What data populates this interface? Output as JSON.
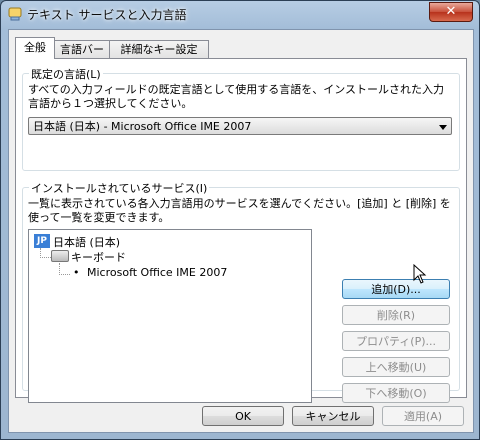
{
  "window": {
    "title": "テキスト サービスと入力言語",
    "close_symbol": "✕"
  },
  "tabs": [
    {
      "label": "全般",
      "active": true
    },
    {
      "label": "言語バー",
      "active": false
    },
    {
      "label": "詳細なキー設定",
      "active": false
    }
  ],
  "default_language": {
    "group_label": "既定の言語(L)",
    "description": "すべての入力フィールドの既定言語として使用する言語を、インストールされた入力言語から１つ選択してください。",
    "selected": "日本語 (日本) - Microsoft Office IME 2007"
  },
  "installed_services": {
    "group_label": "インストールされているサービス(I)",
    "description": "一覧に表示されている各入力言語用のサービスを選んでください。[追加] と [削除] を使って一覧を変更できます。",
    "tree": {
      "language_badge": "JP",
      "language": "日本語 (日本)",
      "category": "キーボード",
      "service": "Microsoft Office IME 2007",
      "bullet": "•"
    },
    "buttons": {
      "add": "追加(D)...",
      "remove": "削除(R)",
      "properties": "プロパティ(P)...",
      "move_up": "上へ移動(U)",
      "move_down": "下へ移動(O)"
    }
  },
  "footer": {
    "ok": "OK",
    "cancel": "キャンセル",
    "apply": "適用(A)"
  }
}
